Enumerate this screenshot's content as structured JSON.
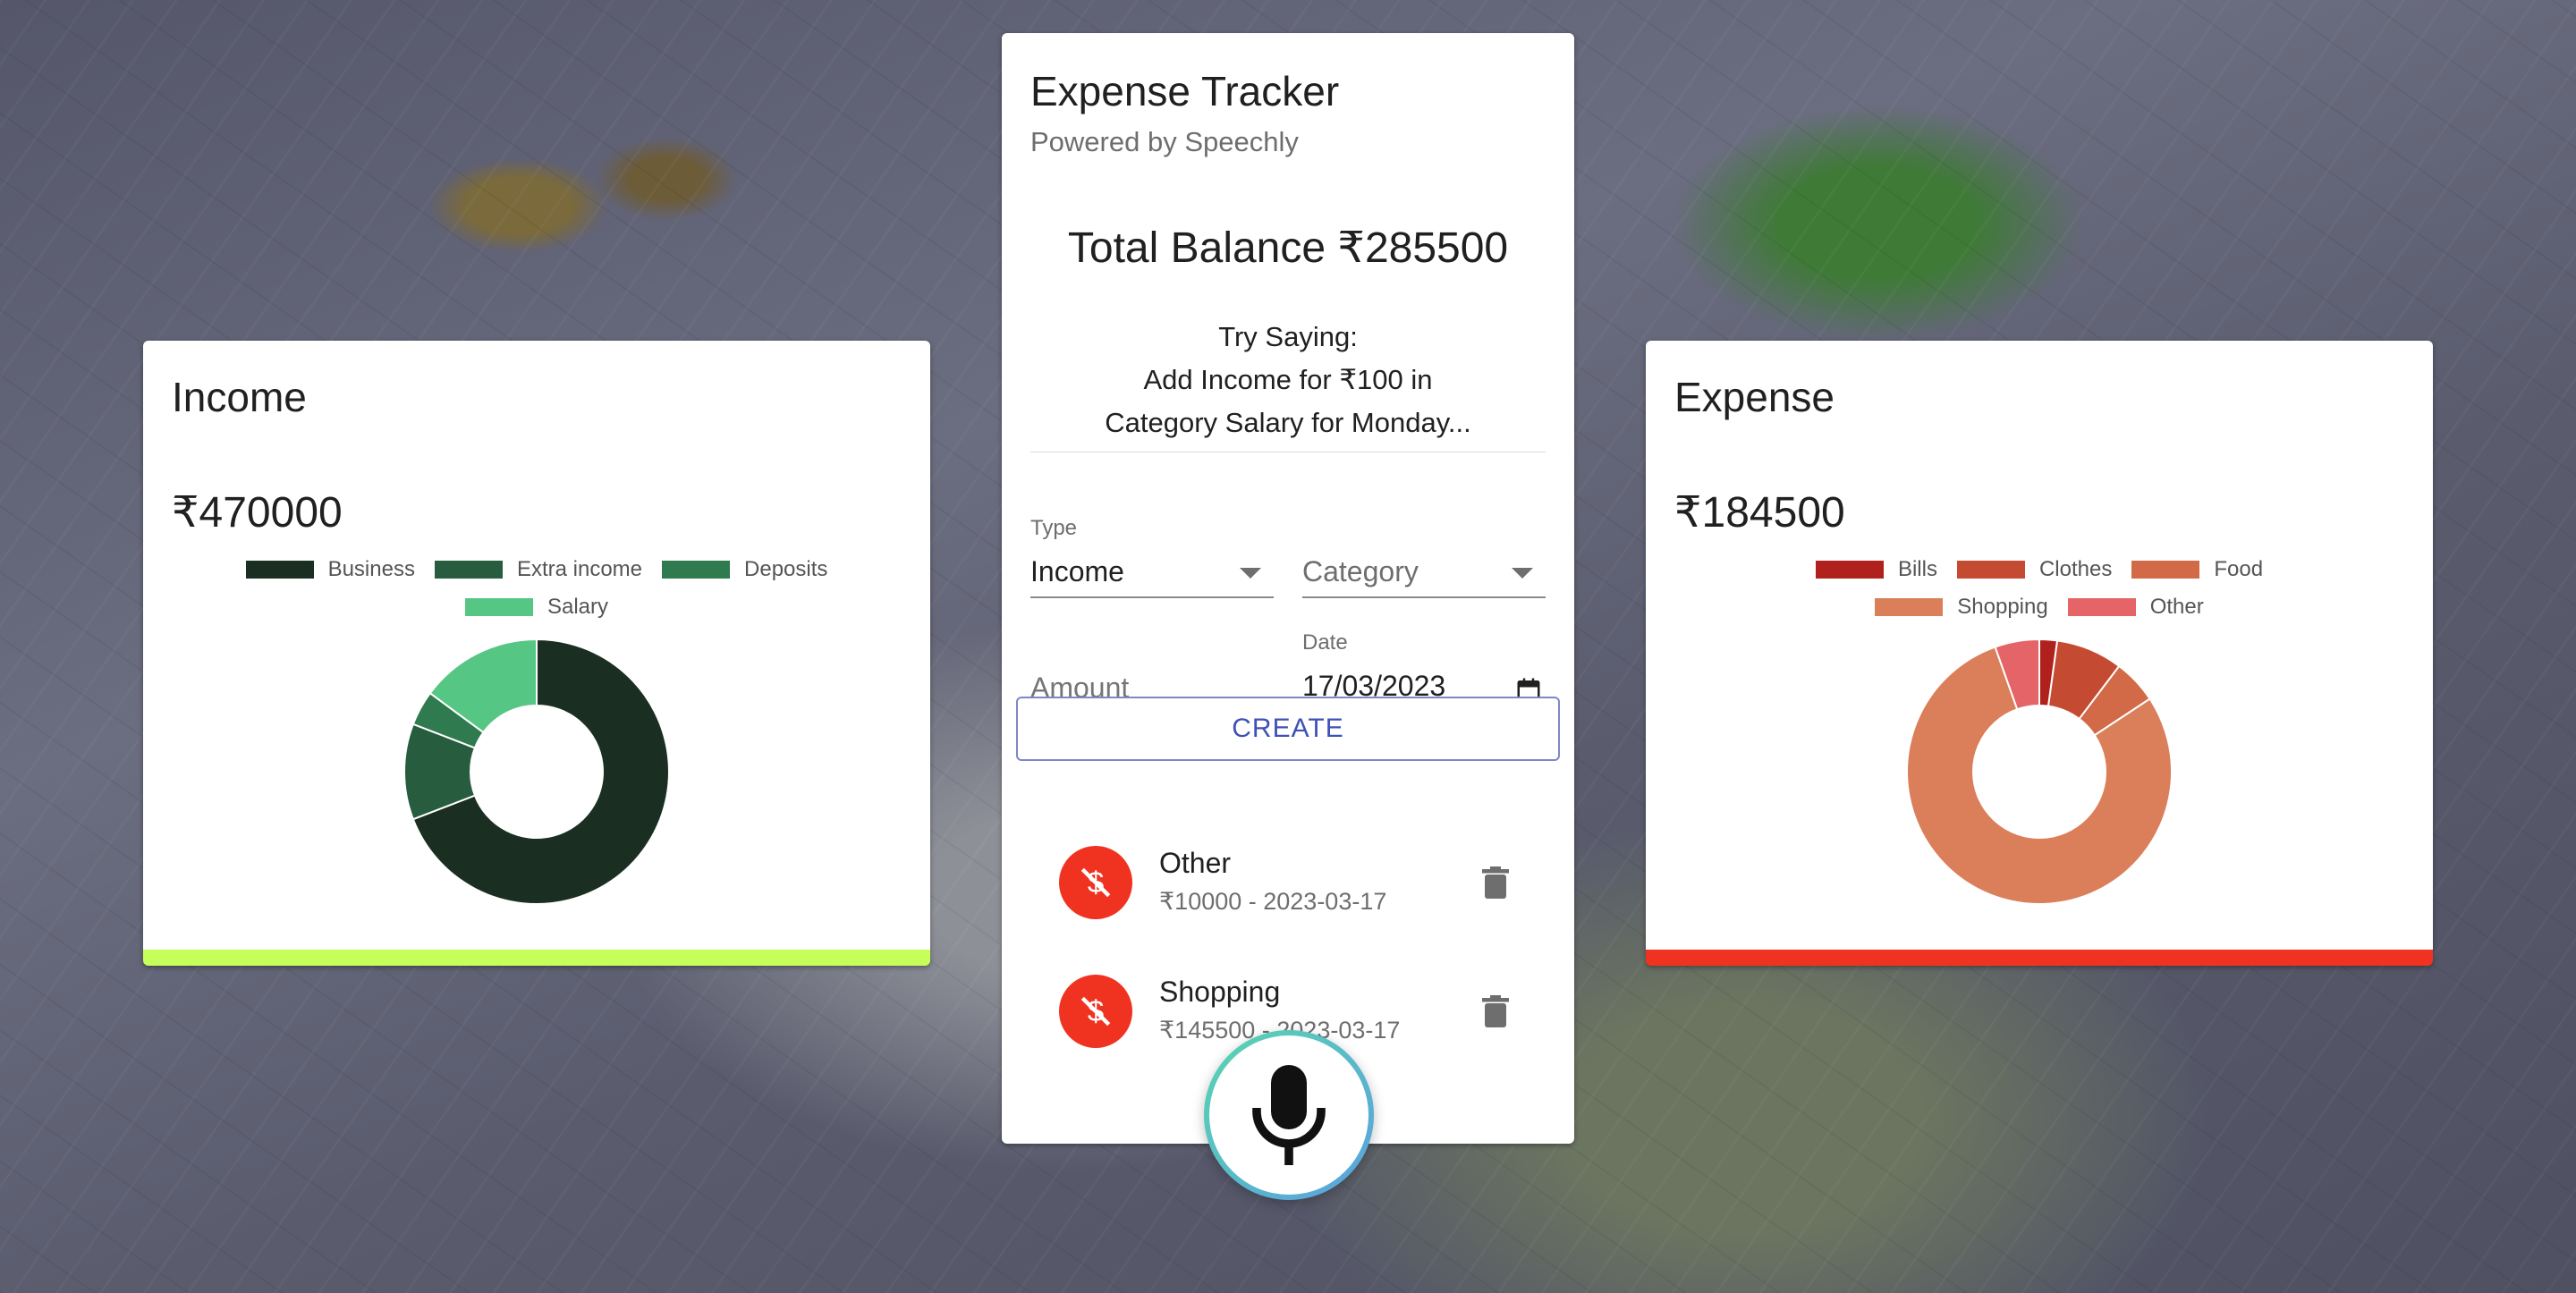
{
  "income": {
    "title": "Income",
    "amount": "₹470000",
    "accent": "#c6ff59"
  },
  "expense": {
    "title": "Expense",
    "amount": "₹184500",
    "accent": "#f03321"
  },
  "tracker": {
    "title": "Expense Tracker",
    "subtitle": "Powered by Speechly",
    "balance": "Total Balance ₹285500",
    "try_line1": "Try Saying:",
    "try_line2": "Add Income for ₹100 in",
    "try_line3": "Category Salary for Monday...",
    "type_label": "Type",
    "type_value": "Income",
    "category_placeholder": "Category",
    "amount_placeholder": "Amount",
    "date_label": "Date",
    "date_value": "17/03/2023",
    "create_label": "CREATE"
  },
  "transactions": [
    {
      "name": "Other",
      "detail": "₹10000 - 2023-03-17"
    },
    {
      "name": "Shopping",
      "detail": "₹145500 - 2023-03-17"
    }
  ],
  "chart_data": [
    {
      "type": "pie",
      "title": "Income",
      "categories": [
        "Business",
        "Extra income",
        "Deposits",
        "Salary"
      ],
      "values": [
        325000,
        55000,
        20000,
        70000
      ],
      "colors": [
        "#1a2f22",
        "#285c3e",
        "#2f7a4e",
        "#56c684"
      ]
    },
    {
      "type": "pie",
      "title": "Expense",
      "categories": [
        "Bills",
        "Clothes",
        "Food",
        "Shopping",
        "Other"
      ],
      "values": [
        4000,
        15000,
        10000,
        145500,
        10000
      ],
      "colors": [
        "#b0211d",
        "#c54a32",
        "#d26a47",
        "#db7e5a",
        "#e56468"
      ]
    }
  ]
}
